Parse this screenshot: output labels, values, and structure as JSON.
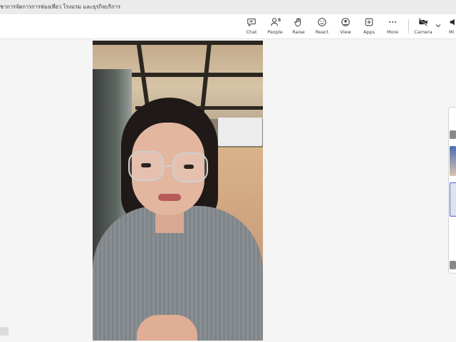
{
  "window": {
    "title": "ชาการจัดการการท่องเที่ยว โรงแรม และธุรกิจบริการ"
  },
  "toolbar": {
    "buttons": [
      {
        "label": "Chat",
        "icon": "chat-icon"
      },
      {
        "label": "People",
        "icon": "people-icon",
        "badge": "8"
      },
      {
        "label": "Raise",
        "icon": "raise-hand-icon"
      },
      {
        "label": "React",
        "icon": "smiley-icon"
      },
      {
        "label": "View",
        "icon": "view-icon"
      },
      {
        "label": "Apps",
        "icon": "apps-icon"
      },
      {
        "label": "More",
        "icon": "more-icon"
      },
      {
        "label": "Camera",
        "icon": "camera-off-icon"
      },
      {
        "label": "Mi",
        "icon": "mic-icon"
      }
    ]
  },
  "colors": {
    "toolbar_bg": "#ffffff",
    "stage_bg": "#f5f5f5",
    "accent": "#5b5fc7"
  }
}
